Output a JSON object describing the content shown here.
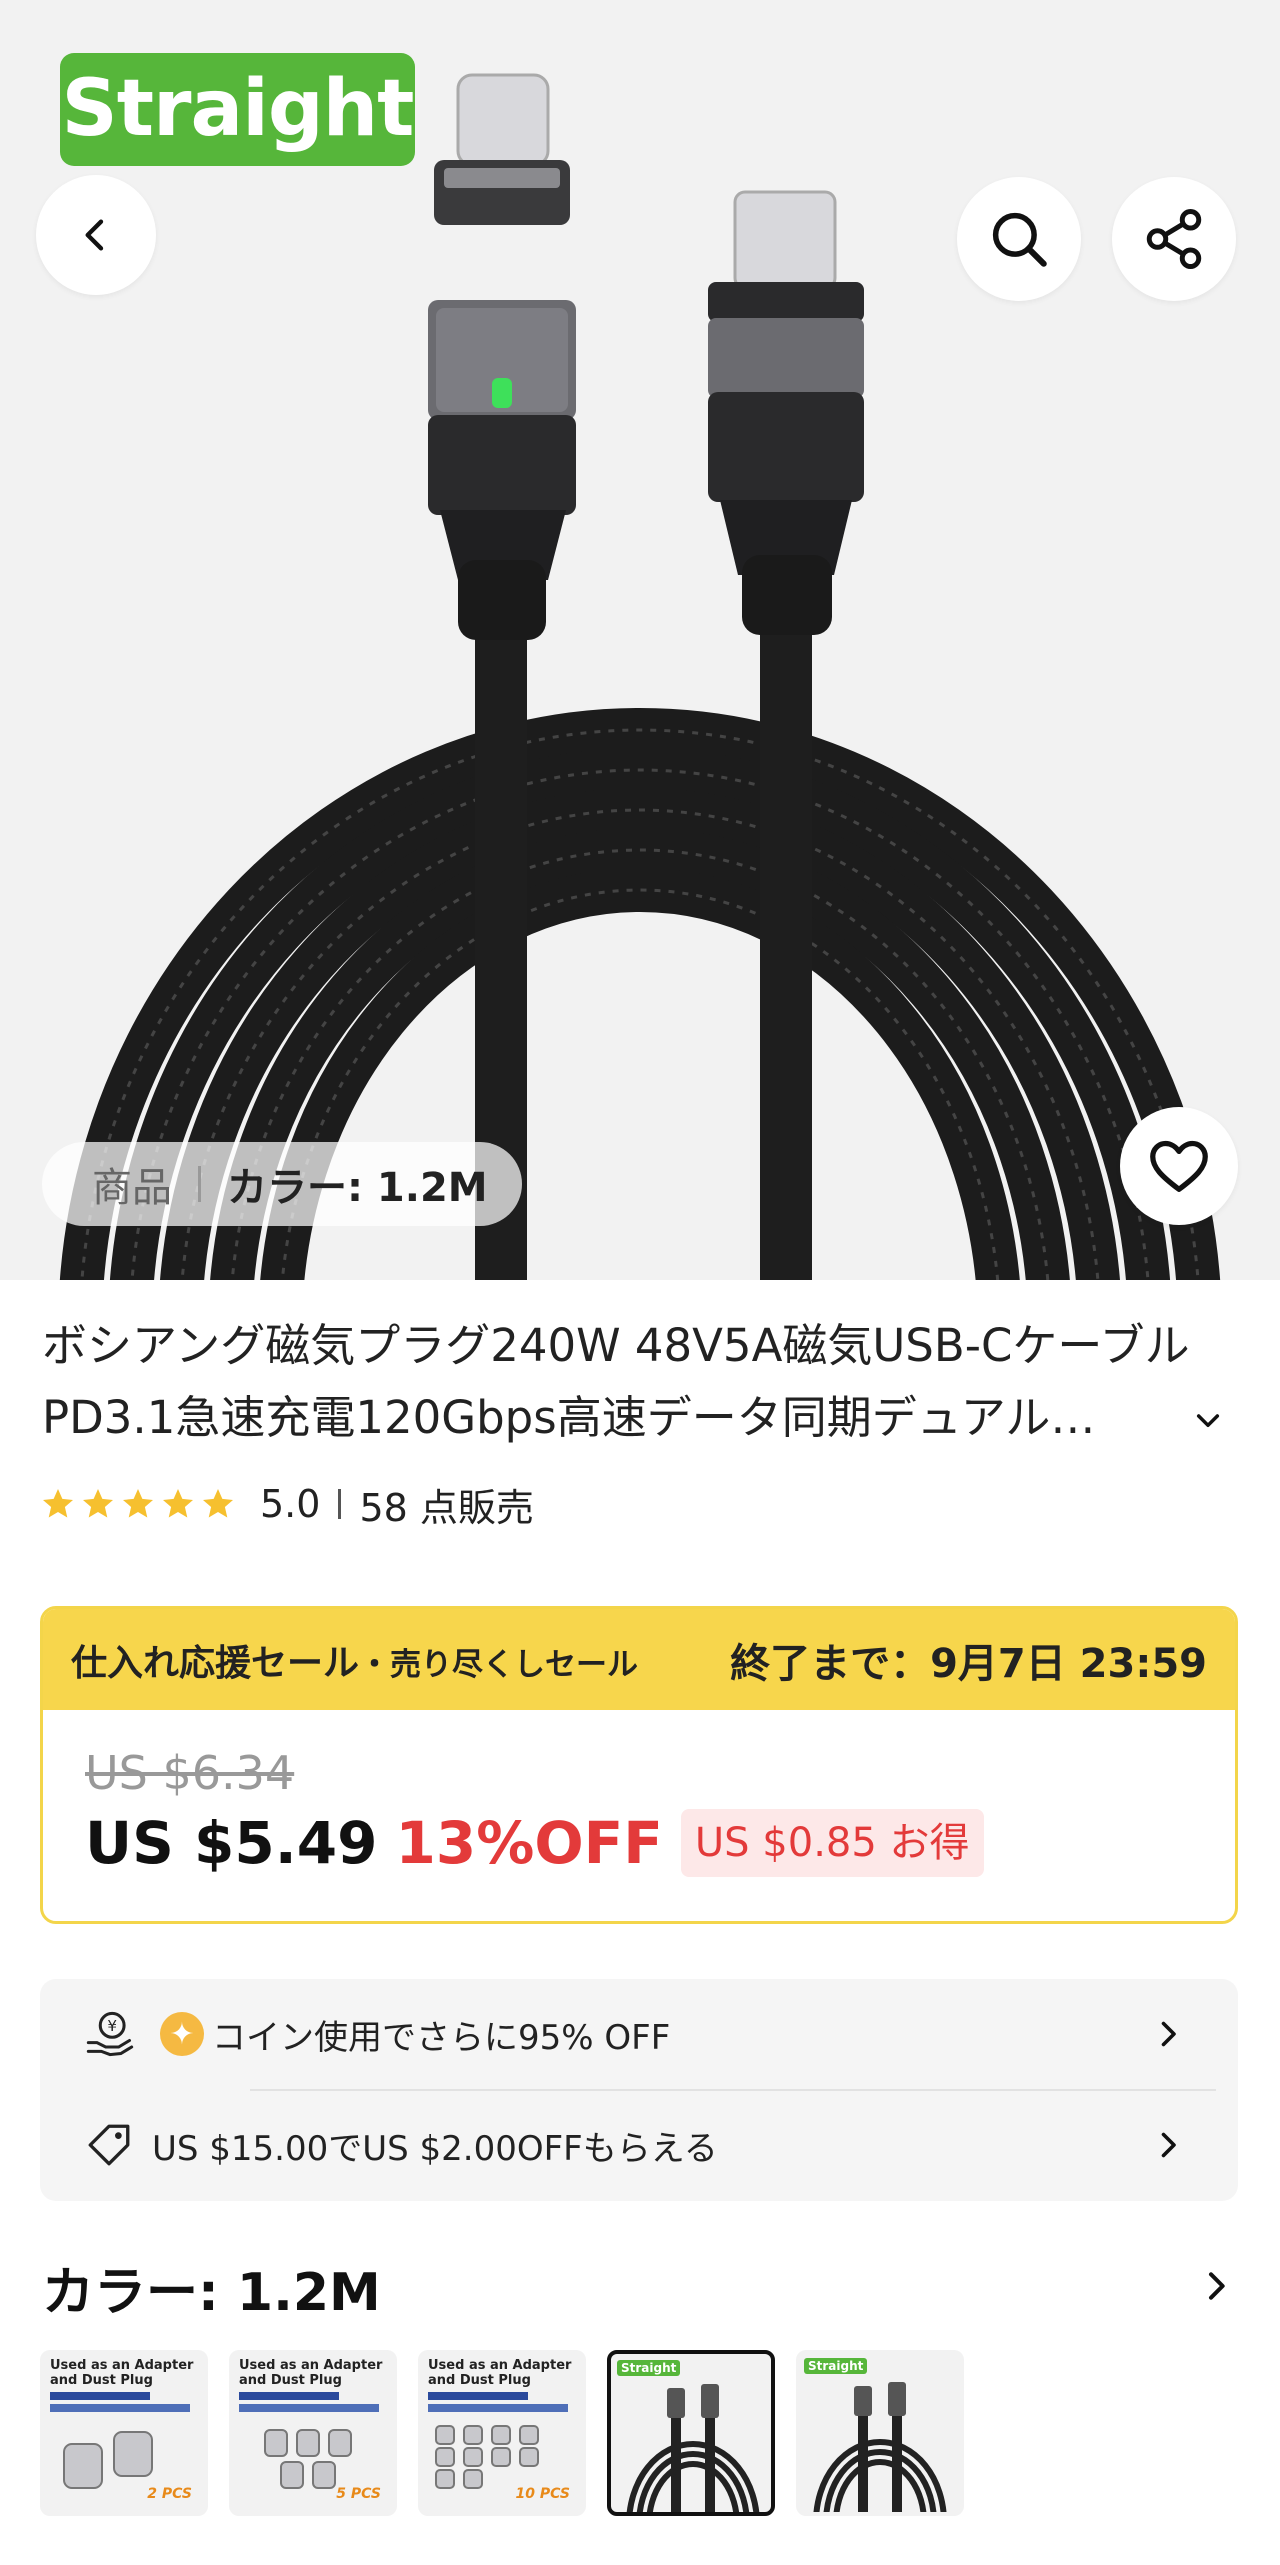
{
  "hero": {
    "badge": "Straight",
    "variant_label": "商品",
    "variant_value": "カラー: 1.2M"
  },
  "icons": {
    "back": "chevron-left-icon",
    "search": "search-icon",
    "share": "share-icon",
    "favorite": "heart-icon",
    "expand": "chevron-down-icon"
  },
  "product": {
    "title": "ボシアング磁気プラグ240W 48V5A磁気USB-CケーブルPD3.1急速充電120Gbps高速データ同期デュアル…",
    "rating": "5.0",
    "sold": "58 点販売",
    "star_count": 5,
    "star_color": "#f6c02f"
  },
  "sale": {
    "name": "仕入れ応援セール",
    "sub": "・売り尽くしセール",
    "ends": "終了まで：9月7日 23:59",
    "original_price": "US $6.34",
    "price": "US $5.49",
    "discount": "13%OFF",
    "savings": "US $0.85 お得",
    "accent_color": "#f7d64c",
    "discount_color": "#e33a3a"
  },
  "coupons": {
    "coin_text": "コイン使用でさらに95% OFF",
    "threshold_text": "US $15.00でUS $2.00OFFもらえる"
  },
  "color": {
    "title": "カラー: 1.2M",
    "swatches": [
      {
        "caption": "Used as an Adapter and Dust Plug",
        "count": "2 PCS"
      },
      {
        "caption": "Used as an Adapter and Dust Plug",
        "count": "5 PCS"
      },
      {
        "caption": "Used as an Adapter and Dust Plug",
        "count": "10 PCS"
      },
      {
        "caption": "Straight",
        "selected": true
      },
      {
        "caption": "Straight"
      }
    ]
  }
}
